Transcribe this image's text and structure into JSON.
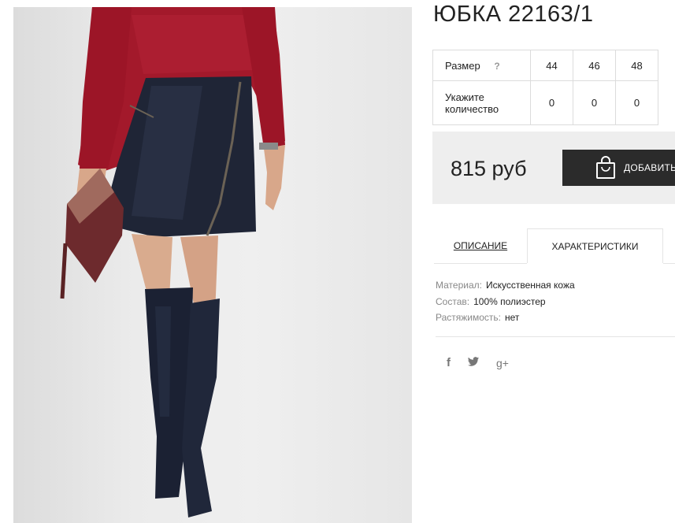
{
  "product": {
    "title": "ЮБКА 22163/1",
    "image_alt": "woman wearing dark leather mini skirt, red sweater and suede over-knee boots"
  },
  "sizes": {
    "size_label": "Размер",
    "help_symbol": "?",
    "qty_label_line1": "Укажите",
    "qty_label_line2": "количество",
    "items": [
      {
        "size": "44",
        "qty": "0"
      },
      {
        "size": "46",
        "qty": "0"
      },
      {
        "size": "48",
        "qty": "0"
      }
    ]
  },
  "price": {
    "text": "815 руб",
    "button_label": "ДОБАВИТЬ",
    "button_icon": "shopping-bag-icon"
  },
  "tabs": [
    {
      "label": "ОПИСАНИЕ",
      "active": false
    },
    {
      "label": "ХАРАКТЕРИСТИКИ",
      "active": true
    }
  ],
  "specs": [
    {
      "key": "Материал:",
      "value": "Искусственная кожа"
    },
    {
      "key": "Состав:",
      "value": "100% полиэстер"
    },
    {
      "key": "Растяжимость:",
      "value": "нет"
    }
  ],
  "social": {
    "facebook": "f",
    "google": "g+"
  },
  "colors": {
    "button_bg": "#2b2b2b",
    "price_box_bg": "#eeeeee",
    "border": "#dcdcdc"
  }
}
